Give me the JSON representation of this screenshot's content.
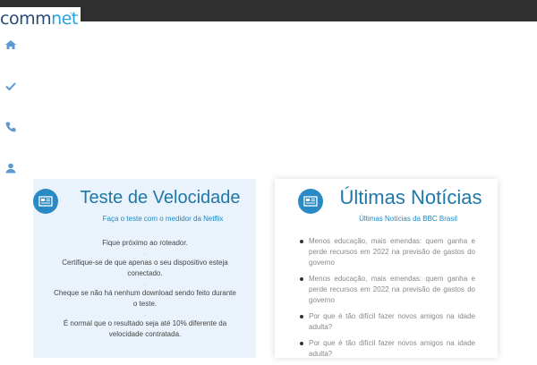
{
  "brand": {
    "logo_part1": "comm",
    "logo_part2": "net"
  },
  "sidebar": {
    "items": [
      {
        "icon": "home-icon"
      },
      {
        "icon": "check-icon"
      },
      {
        "icon": "phone-icon"
      },
      {
        "icon": "user-icon"
      }
    ]
  },
  "speed_card": {
    "icon": "newspaper-icon",
    "title": "Teste de Velocidade",
    "subtitle": "Faça o teste com o medidor da Netflix",
    "tips": [
      "Fique próximo ao roteador.",
      "Certifique-se de que apenas o seu dispositivo esteja conectado.",
      "Cheque se não há nenhum download sendo feito durante o teste.",
      "É normal que o resultado seja até 10% diferente da velocidade contratada."
    ],
    "separator": "."
  },
  "news_card": {
    "icon": "newspaper-icon",
    "title": "Últimas Notícias",
    "subtitle": "Últimas Notícias da BBC Brasil",
    "items": [
      "Menos educação, mais emendas: quem ganha e perde recursos em 2022 na previsão de gastos do governo",
      "Menos educação, mais emendas: quem ganha e perde recursos em 2022 na previsão de gastos do governo",
      "Por que é tão difícil fazer novos amigos na idade adulta?",
      "Por que é tão difícil fazer novos amigos na idade adulta?"
    ]
  },
  "colors": {
    "accent": "#2a8ac4",
    "topbar": "#2f2f2f",
    "speed_bg": "#eaf3fb"
  }
}
